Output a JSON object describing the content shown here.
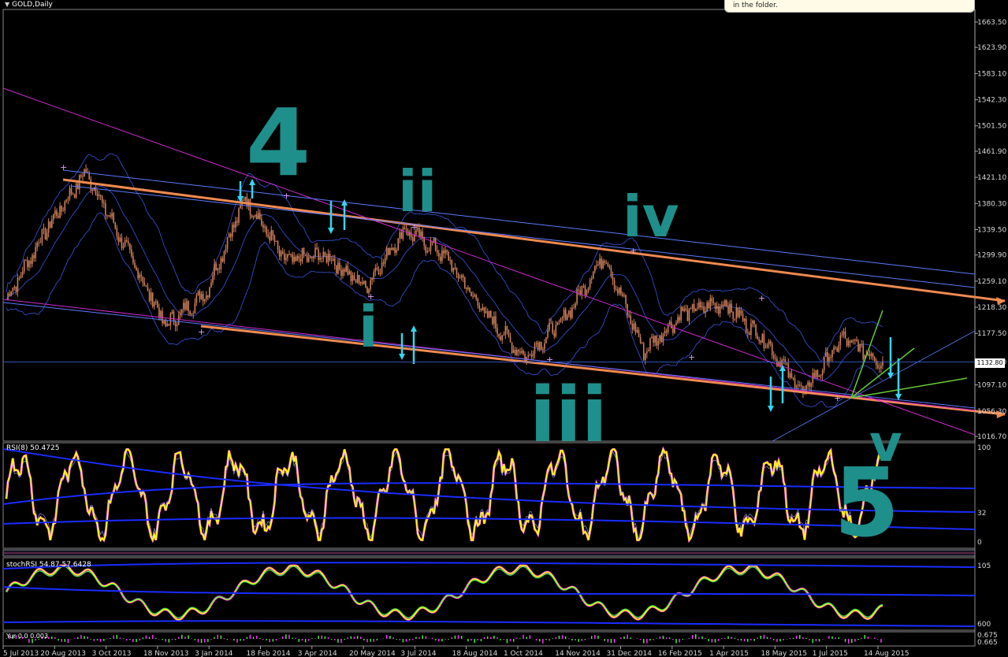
{
  "header": {
    "symbol": "GOLD,Daily",
    "tooltip_text": "in the folder."
  },
  "colors": {
    "background": "#000000",
    "candle": "#cd7f5a",
    "bollinger": "#3a55e0",
    "channel_orange": "#f08a50",
    "trend_magenta": "#d02ad0",
    "annotation_teal": "#1e8f8a",
    "arrow_cyan": "#33d6f0",
    "rsi_yellow": "#ffff00",
    "rsi_magenta": "#ff33ff",
    "stoch_green": "#44ee44",
    "fib_green": "#66cc33"
  },
  "price_axis": {
    "ticks": [
      "1663.50",
      "1623.90",
      "1583.10",
      "1542.30",
      "1501.50",
      "1461.90",
      "1421.10",
      "1380.30",
      "1339.50",
      "1299.90",
      "1259.10",
      "1218.30",
      "1177.50",
      "1132.80",
      "1097.10",
      "1056.30",
      "1016.70"
    ],
    "current_price": "1132.80"
  },
  "time_axis": {
    "labels": [
      "5 Jul 2013",
      "20 Aug 2013",
      "3 Oct 2013",
      "18 Nov 2013",
      "3 Jan 2014",
      "18 Feb 2014",
      "3 Apr 2014",
      "20 May 2014",
      "3 Jul 2014",
      "18 Aug 2014",
      "1 Oct 2014",
      "14 Nov 2014",
      "31 Dec 2014",
      "16 Feb 2015",
      "1 Apr 2015",
      "18 May 2015",
      "1 Jul 2015",
      "14 Aug 2015"
    ]
  },
  "annotations": {
    "wave_4": "4",
    "wave_ii": "ii",
    "wave_iv": "iv",
    "wave_i": "i",
    "wave_iii": "iii",
    "wave_v": "v",
    "wave_5": "5"
  },
  "indicators": {
    "rsi": {
      "label": "RSI(8) 50.4725",
      "ticks": [
        "100",
        "32",
        "0"
      ]
    },
    "stochrsi": {
      "label": "stochRSI 54.87 57.6428",
      "ticks": [
        "105",
        "600"
      ]
    },
    "bottom": {
      "label": "Yur 0.0 0.003",
      "ticks": [
        "0.675",
        "0.665"
      ]
    }
  },
  "chart_data": {
    "type": "candlestick",
    "title": "GOLD,Daily",
    "y_range": [
      1000,
      1680
    ],
    "key_points": [
      {
        "date": "5 Jul 2013",
        "close": 1230
      },
      {
        "date": "Aug 2013",
        "close": 1340
      },
      {
        "date": "28 Aug 2013",
        "close": 1430
      },
      {
        "date": "Oct 2013",
        "close": 1310
      },
      {
        "date": "Dec 2013",
        "close": 1190
      },
      {
        "date": "Jan 2014",
        "close": 1240
      },
      {
        "date": "Mar 2014",
        "close": 1390
      },
      {
        "date": "Apr 2014",
        "close": 1290
      },
      {
        "date": "May 2014",
        "close": 1300
      },
      {
        "date": "Jun 2014",
        "close": 1250
      },
      {
        "date": "Jul 2014",
        "close": 1340
      },
      {
        "date": "Aug 2014",
        "close": 1300
      },
      {
        "date": "Oct 2014",
        "close": 1210
      },
      {
        "date": "Nov 2014",
        "close": 1140
      },
      {
        "date": "Dec 2014",
        "close": 1200
      },
      {
        "date": "Jan 2015",
        "close": 1300
      },
      {
        "date": "Mar 2015",
        "close": 1150
      },
      {
        "date": "Apr 2015",
        "close": 1210
      },
      {
        "date": "May 2015",
        "close": 1225
      },
      {
        "date": "Jun 2015",
        "close": 1170
      },
      {
        "date": "Jul 2015",
        "close": 1085
      },
      {
        "date": "Aug 2015",
        "close": 1170
      },
      {
        "date": "21 Aug 2015",
        "close": 1132.8
      }
    ]
  }
}
